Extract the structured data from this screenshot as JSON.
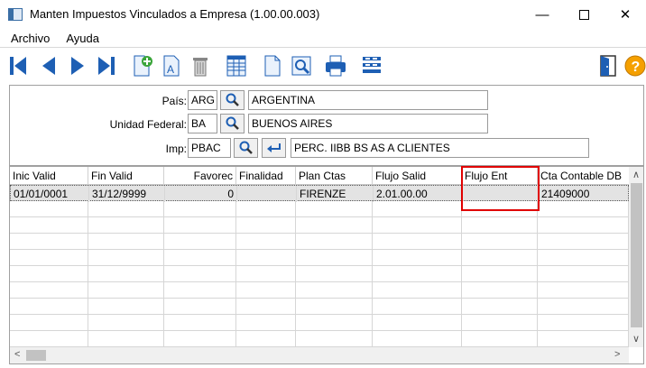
{
  "window": {
    "title": "Manten Impuestos Vinculados a Empresa (1.00.00.003)",
    "min_glyph": "—",
    "close_glyph": "✕"
  },
  "menu": {
    "items": [
      "Archivo",
      "Ayuda"
    ]
  },
  "toolbar": {
    "icons": [
      "first-record-icon",
      "prev-record-icon",
      "next-record-icon",
      "last-record-icon",
      "new-record-icon",
      "edit-text-icon",
      "delete-icon",
      "grid-view-icon",
      "document-icon",
      "preview-icon",
      "print-icon",
      "list-icon",
      "exit-door-icon",
      "help-icon"
    ],
    "accent": "#1e5fb4"
  },
  "form": {
    "pais": {
      "label": "País:",
      "code": "ARG",
      "name": "ARGENTINA"
    },
    "unidad_federal": {
      "label": "Unidad Federal:",
      "code": "BA",
      "name": "BUENOS AIRES"
    },
    "imp": {
      "label": "Imp:",
      "code": "PBAC",
      "name": "PERC. IIBB BS AS A CLIENTES"
    }
  },
  "grid": {
    "columns": [
      "Inic Valid",
      "Fin Valid",
      "Favorec",
      "Finalidad",
      "Plan Ctas",
      "Flujo Salid",
      "Flujo Ent",
      "Cta Contable DB"
    ],
    "rows": [
      [
        "01/01/0001",
        "31/12/9999",
        "0",
        "",
        "FIRENZE",
        "2.01.00.00",
        "",
        "21409000"
      ]
    ],
    "scroll_up": "∧",
    "scroll_down": "∨",
    "scroll_left": "<",
    "scroll_right": ">"
  }
}
